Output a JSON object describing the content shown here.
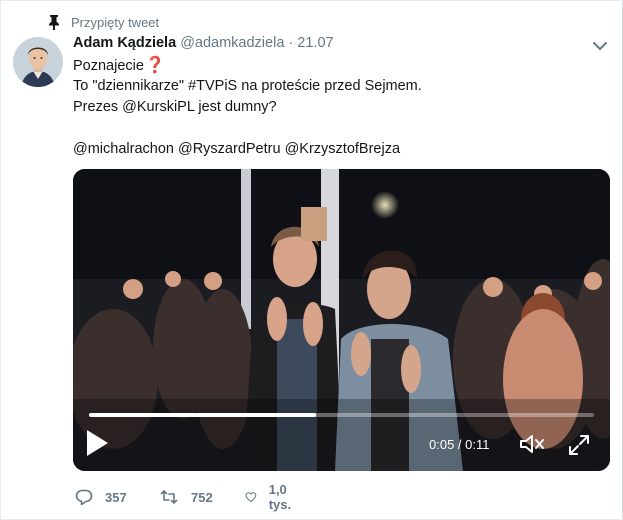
{
  "pinned_label": "Przypięty tweet",
  "author": {
    "display_name": "Adam Kądziela",
    "handle": "@adamkadziela",
    "separator": "·",
    "date": "21.07"
  },
  "tweet": {
    "line1": "Poznajecie",
    "line2": "To \"dziennikarze\" #TVPiS na proteście przed Sejmem.",
    "line3": "Prezes @KurskiPL jest dumny?",
    "line4": "@michalrachon @RyszardPetru @KrzysztofBrejza"
  },
  "video": {
    "time": "0:05 / 0:11",
    "progress": 0.45
  },
  "actions": {
    "replies": "357",
    "retweets": "752",
    "likes": "1,0 tys."
  },
  "colors": {
    "accent": "#1da1f2",
    "muted": "#657786",
    "text": "#14171a",
    "emoji_red": "#e0263c"
  }
}
